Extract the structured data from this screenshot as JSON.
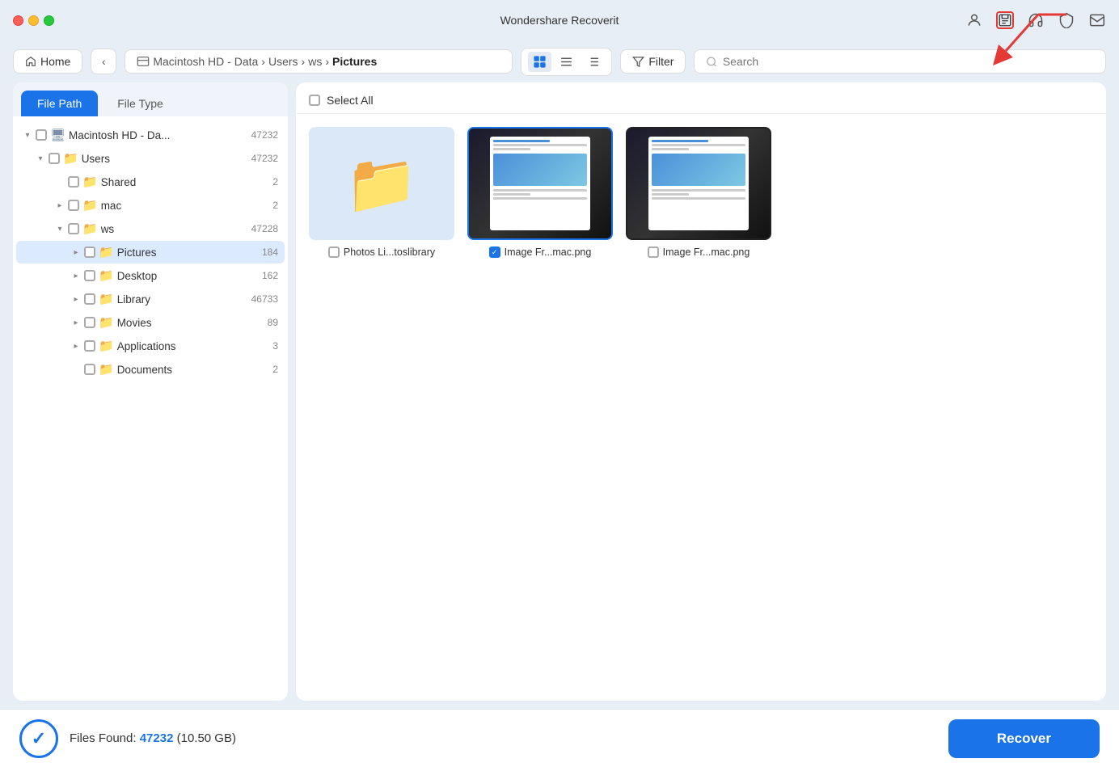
{
  "app": {
    "title": "Wondershare Recoverit"
  },
  "titlebar": {
    "icons": [
      "person-icon",
      "save-icon",
      "headphone-icon",
      "shield-icon",
      "mail-icon"
    ]
  },
  "toolbar": {
    "home_label": "Home",
    "back_label": "‹",
    "breadcrumb": {
      "drive": "Macintosh HD - Data",
      "sep1": ">",
      "users": "Users",
      "sep2": ">",
      "ws": "ws",
      "sep3": ">",
      "current": "Pictures"
    },
    "filter_label": "Filter",
    "search_placeholder": "Search"
  },
  "sidebar": {
    "tabs": [
      {
        "label": "File Path",
        "active": true
      },
      {
        "label": "File Type",
        "active": false
      }
    ],
    "tree": {
      "root": {
        "label": "Macintosh HD - Da...",
        "count": "47232",
        "children": {
          "users": {
            "label": "Users",
            "count": "47232",
            "children": {
              "shared": {
                "label": "Shared",
                "count": "2"
              },
              "mac": {
                "label": "mac",
                "count": "2"
              },
              "ws": {
                "label": "ws",
                "count": "47228",
                "children": {
                  "pictures": {
                    "label": "Pictures",
                    "count": "184",
                    "selected": true
                  },
                  "desktop": {
                    "label": "Desktop",
                    "count": "162"
                  },
                  "library": {
                    "label": "Library",
                    "count": "46733"
                  },
                  "movies": {
                    "label": "Movies",
                    "count": "89"
                  },
                  "applications": {
                    "label": "Applications",
                    "count": "3"
                  },
                  "documents": {
                    "label": "Documents",
                    "count": "2"
                  }
                }
              }
            }
          }
        }
      }
    }
  },
  "file_area": {
    "select_all_label": "Select All",
    "files": [
      {
        "name": "Photos Li...toslibrary",
        "type": "folder",
        "selected": false
      },
      {
        "name": "Image Fr...mac.png",
        "type": "image",
        "selected": true
      },
      {
        "name": "Image Fr...mac.png",
        "type": "image",
        "selected": false
      }
    ]
  },
  "bottom": {
    "files_found_label": "Files Found:",
    "count": "47232",
    "size": "(10.50 GB)",
    "recover_label": "Recover"
  }
}
